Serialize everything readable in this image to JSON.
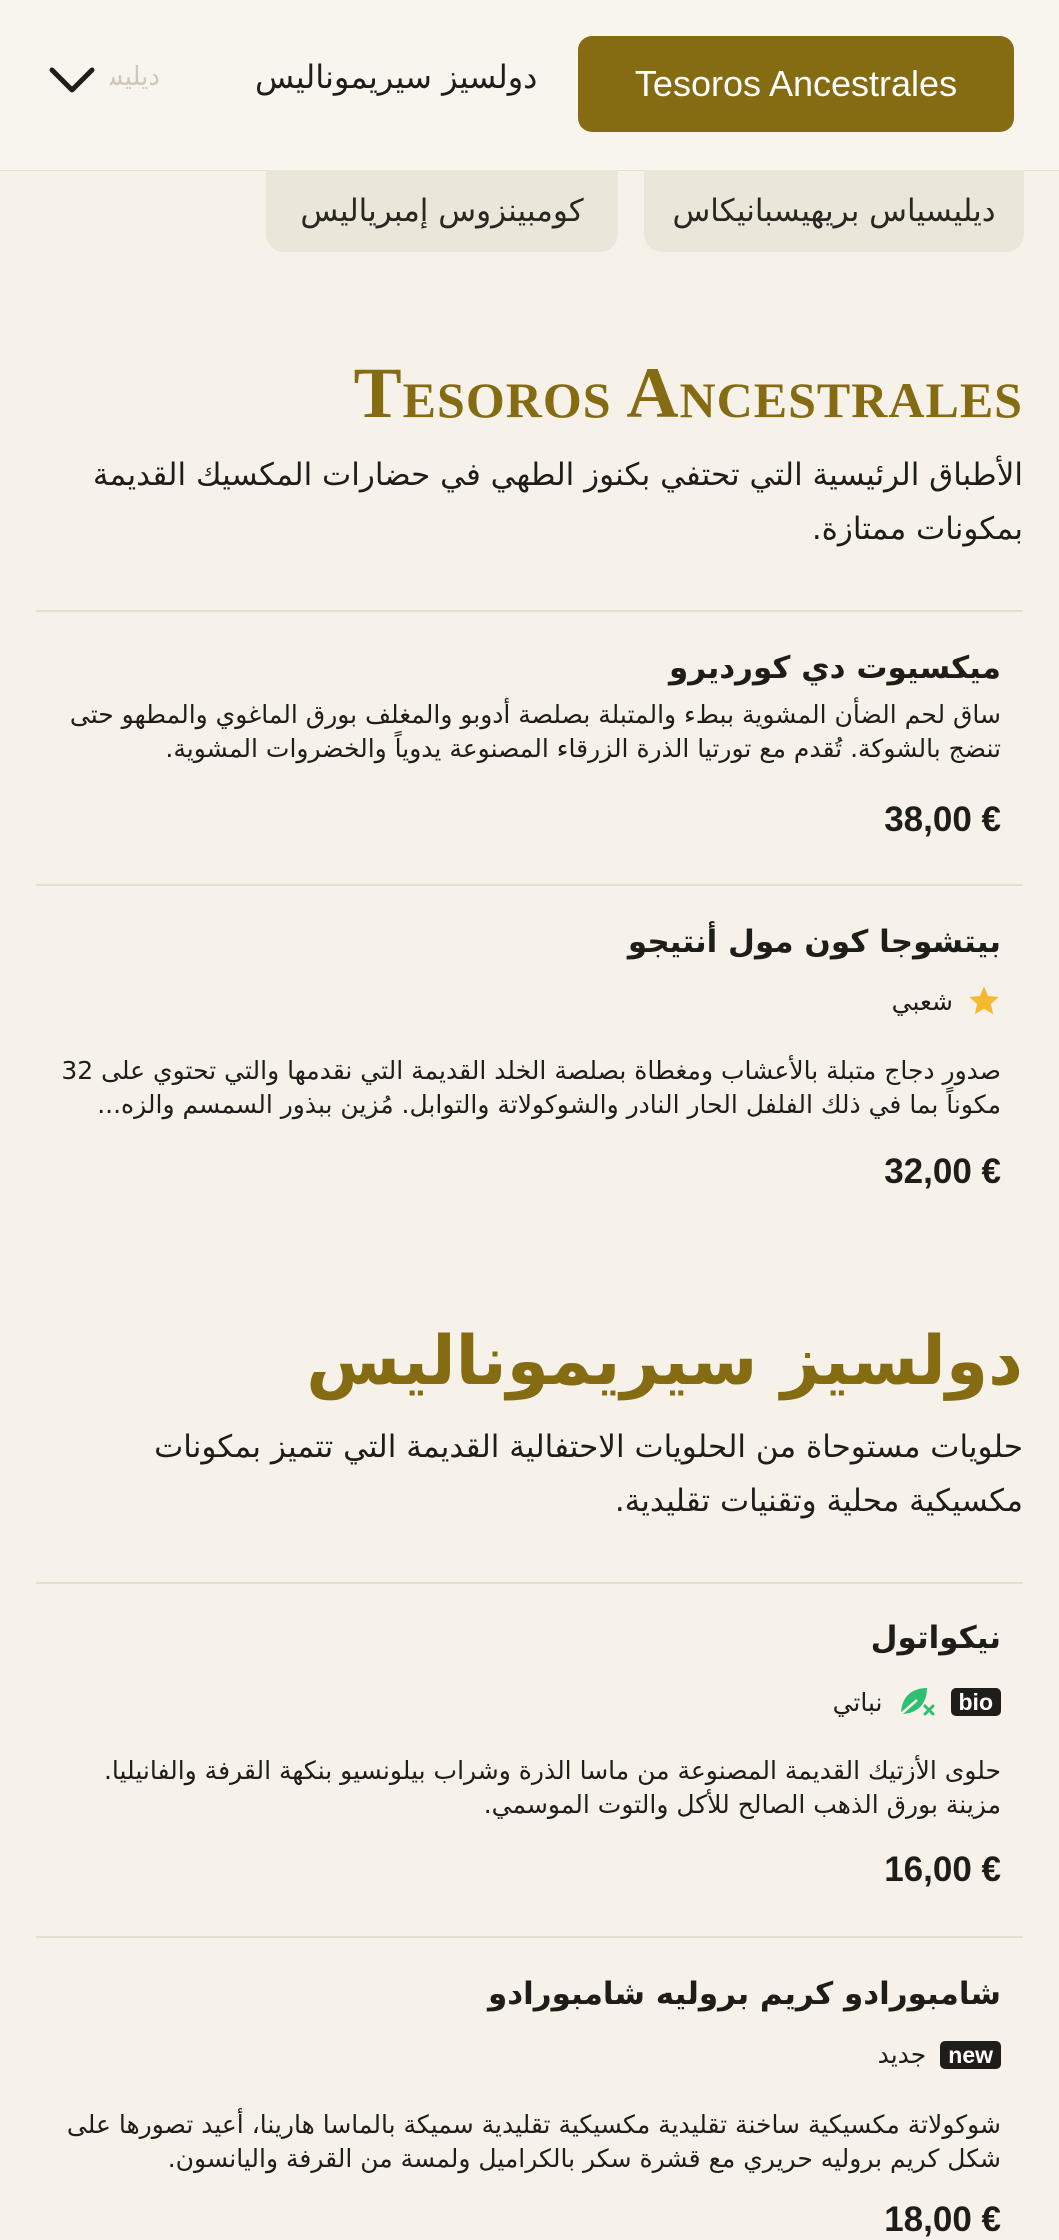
{
  "nav": {
    "faded_label": "ديليسياس",
    "link_label": "دولسيز سيريموناليس",
    "active_label": "Tesoros Ancestrales",
    "pills": [
      "كومبينزوس إمبرياليس",
      "ديليسياس بريهيسبانيكاس"
    ]
  },
  "sections": [
    {
      "title": "Tesoros Ancestrales",
      "description": "الأطباق الرئيسية التي تحتفي بكنوز الطهي في حضارات المكسيك القديمة بمكونات ممتازة.",
      "items": [
        {
          "name": "ميكسيوت دي كورديرو",
          "description": "ساق لحم الضأن المشوية ببطء والمتبلة بصلصة أدوبو والمغلف بورق الماغوي والمطهو حتى تنضج بالشوكة. تُقدم مع تورتيا الذرة الزرقاء المصنوعة يدوياً والخضروات المشوية.",
          "price": "38,00 €"
        },
        {
          "name": "بيتشوجا كون مول أنتيجو",
          "tag": "شعبي",
          "description": "صدور دجاج متبلة بالأعشاب ومغطاة بصلصة الخلد القديمة التي نقدمها والتي تحتوي على 32 مكوناً بما في ذلك الفلفل الحار النادر والشوكولاتة والتوابل. مُزين ببذور السمسم والزه...",
          "price": "32,00 €"
        }
      ]
    },
    {
      "title": "دولسيز سيريموناليس",
      "description": "حلويات مستوحاة من الحلويات الاحتفالية القديمة التي تتميز بمكونات مكسيكية محلية وتقنيات تقليدية.",
      "items": [
        {
          "name": "نيكواتول",
          "badge": "bio",
          "tag": "نباتي",
          "description": "حلوى الأزتيك القديمة المصنوعة من ماسا الذرة وشراب بيلونسيو بنكهة القرفة والفانيليا. مزينة بورق الذهب الصالح للأكل والتوت الموسمي.",
          "price": "16,00 €"
        },
        {
          "name": "شامبورادو كريم بروليه شامبورادو",
          "badge": "new",
          "tag": "جديد",
          "description": "شوكولاتة مكسيكية ساخنة تقليدية مكسيكية تقليدية سميكة بالماسا هارينا، أعيد تصورها على شكل كريم بروليه حريري مع قشرة سكر بالكراميل ولمسة من القرفة واليانسون.",
          "price": "18,00 €"
        }
      ]
    }
  ],
  "colors": {
    "accent": "#856b12",
    "background": "#f6f2ea",
    "star": "#f5b82e",
    "leaf": "#2fbf71"
  }
}
